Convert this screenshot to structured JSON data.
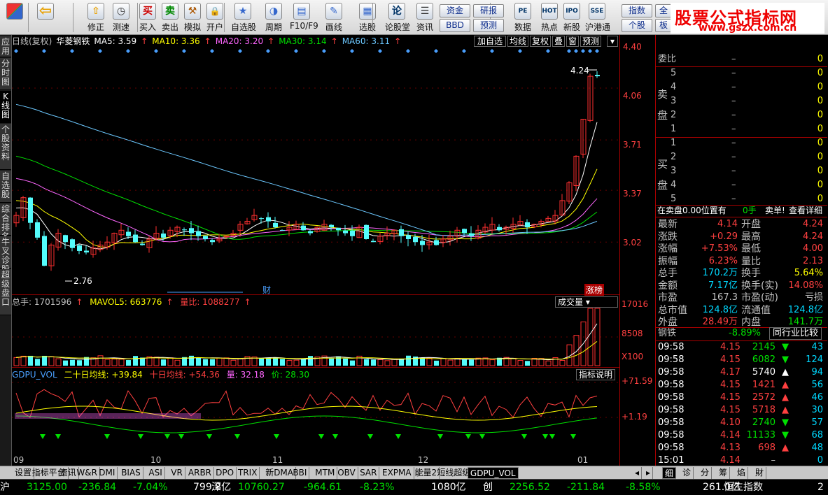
{
  "toolbar": {
    "buttons": [
      {
        "label": "",
        "icon": "app-grid-icon"
      },
      {
        "label": "",
        "icon": "back-arrow-icon"
      },
      {
        "label": "修正",
        "icon": "fix-icon"
      },
      {
        "label": "测速",
        "icon": "clock-icon"
      },
      {
        "label": "买入",
        "icon": "buy-icon",
        "glyph": "买"
      },
      {
        "label": "卖出",
        "icon": "sell-icon",
        "glyph": "卖"
      },
      {
        "label": "模拟",
        "icon": "hammer-icon"
      },
      {
        "label": "开户",
        "icon": "lock-icon"
      },
      {
        "label": "自选股",
        "icon": "star-icon"
      },
      {
        "label": "周期",
        "icon": "period-icon"
      },
      {
        "label": "F10/F9",
        "icon": "f10-icon"
      },
      {
        "label": "画线",
        "icon": "pen-icon"
      },
      {
        "label": "选股",
        "icon": "select-icon"
      },
      {
        "label": "论股堂",
        "icon": "discuss-icon",
        "glyph": "论"
      },
      {
        "label": "资讯",
        "icon": "news-icon"
      },
      {
        "label": "数据",
        "icon": "pe-icon",
        "glyph": "PE"
      },
      {
        "label": "热点",
        "icon": "hot-icon",
        "glyph": "HOT"
      },
      {
        "label": "新股",
        "icon": "ipo-icon",
        "glyph": "IPO"
      },
      {
        "label": "沪港通",
        "icon": "sse-hkex-icon",
        "glyph": "SSE"
      }
    ],
    "small": [
      {
        "label": "资金"
      },
      {
        "label": "BBD"
      },
      {
        "label": "研报"
      },
      {
        "label": "预测"
      },
      {
        "label": "指数"
      },
      {
        "label": "个股"
      },
      {
        "label": "全"
      },
      {
        "label": "板"
      }
    ]
  },
  "logo": {
    "title": "股票公式指标网",
    "url": "www.gszx.com.cn"
  },
  "left_tabs": [
    "应用",
    "分时图",
    "K线图",
    "个股资料",
    "自选股",
    "综合排名",
    "牛叉诊股",
    "超级盘口"
  ],
  "main": {
    "period": "日线(复权)",
    "stock_name": "华菱钢铁",
    "ma": [
      {
        "label": "MA5: 3.59",
        "color": "#ffffff"
      },
      {
        "label": "MA10: 3.36",
        "color": "#ffff00"
      },
      {
        "label": "MA20: 3.20",
        "color": "#ff66ff"
      },
      {
        "label": "MA30: 3.14",
        "color": "#00e000"
      },
      {
        "label": "MA60: 3.11",
        "color": "#6cc8ff"
      }
    ],
    "buttons": [
      "加自选",
      "均线",
      "复权",
      "叠",
      "窗",
      "预测"
    ],
    "high_label": "4.24",
    "low_label": "2.76",
    "cai_label": "财",
    "zhang_label": "涨榜",
    "watermark": "华菱钢铁 000932"
  },
  "volume": {
    "label_total": "总手: 1701596",
    "label_mavol": "MAVOL5: 663776",
    "label_ratio": "量比: 1088277",
    "menu": "成交量"
  },
  "indicator": {
    "name": "GDPU_VOL",
    "ma20": "二十日均线: +39.84",
    "ma10": "十日均线: +54.36",
    "vol": "量: 32.18",
    "price": "价: 28.30",
    "help": "指标说明"
  },
  "y_axis": {
    "price": [
      "4.40",
      "4.06",
      "3.71",
      "3.37",
      "3.02"
    ],
    "volume": [
      "17016",
      "8508",
      "X100"
    ],
    "indicator": [
      "+71.59",
      "+1.19"
    ]
  },
  "x_axis": [
    "09",
    "10",
    "11",
    "12",
    "01"
  ],
  "chart_data": {
    "type": "candlestick",
    "title": "华菱钢铁 日线(复权)",
    "ylim": [
      2.7,
      4.4
    ],
    "x_ticks": [
      "09",
      "10",
      "11",
      "12",
      "01"
    ],
    "last_close": 4.14,
    "period_high": 4.24,
    "period_low": 2.76,
    "ma_latest": {
      "MA5": 3.59,
      "MA10": 3.36,
      "MA20": 3.2,
      "MA30": 3.14,
      "MA60": 3.11
    },
    "volume_ylim": [
      0,
      17016
    ],
    "volume_ticks": [
      17016,
      8508
    ]
  },
  "right": {
    "order_ratio": "委比",
    "order_ratio_val": "–",
    "order_ratio_num": "0",
    "sell_label": "卖盘",
    "buy_label": "买盘",
    "sell": [
      {
        "lvl": "5",
        "p": "–",
        "v": "0"
      },
      {
        "lvl": "4",
        "p": "–",
        "v": "0"
      },
      {
        "lvl": "3",
        "p": "–",
        "v": "0"
      },
      {
        "lvl": "2",
        "p": "–",
        "v": "0"
      },
      {
        "lvl": "1",
        "p": "–",
        "v": "0"
      }
    ],
    "buy": [
      {
        "lvl": "1",
        "p": "–",
        "v": "0"
      },
      {
        "lvl": "2",
        "p": "–",
        "v": "0"
      },
      {
        "lvl": "3",
        "p": "–",
        "v": "0"
      },
      {
        "lvl": "4",
        "p": "–",
        "v": "0"
      },
      {
        "lvl": "5",
        "p": "–",
        "v": "0"
      }
    ],
    "notice": "在卖盘0.00位置有",
    "notice_val": "0手",
    "notice_btn1": "卖单!",
    "notice_btn2": "查看详细",
    "stats": [
      [
        "最新",
        "4.14",
        "开盘",
        "4.24"
      ],
      [
        "涨跌",
        "+0.29",
        "最高",
        "4.24"
      ],
      [
        "涨幅",
        "+7.53%",
        "最低",
        "4.00"
      ],
      [
        "振幅",
        "6.23%",
        "量比",
        "2.13"
      ],
      [
        "总手",
        "170.2万",
        "换手",
        "5.64%"
      ],
      [
        "金额",
        "7.17亿",
        "换手(实)",
        "14.08%"
      ],
      [
        "市盈",
        "167.3",
        "市盈(动)",
        "亏损"
      ],
      [
        "总市值",
        "124.8亿",
        "流通值",
        "124.8亿"
      ],
      [
        "外盘",
        "28.49万",
        "内盘",
        "141.7万"
      ]
    ],
    "sector": "钢铁",
    "sector_pct": "-8.89%",
    "sector_btn": "同行业比较",
    "ticks": [
      {
        "t": "09:58",
        "p": "4.15",
        "v": "2145",
        "d": "down",
        "n": "43"
      },
      {
        "t": "09:58",
        "p": "4.15",
        "v": "6082",
        "d": "down",
        "n": "124"
      },
      {
        "t": "09:58",
        "p": "4.17",
        "v": "5740",
        "d": "up",
        "n": "94"
      },
      {
        "t": "09:58",
        "p": "4.15",
        "v": "1421",
        "d": "up",
        "n": "56"
      },
      {
        "t": "09:58",
        "p": "4.15",
        "v": "2572",
        "d": "up",
        "n": "46"
      },
      {
        "t": "09:58",
        "p": "4.15",
        "v": "5718",
        "d": "up",
        "n": "30"
      },
      {
        "t": "09:58",
        "p": "4.10",
        "v": "2740",
        "d": "down",
        "n": "57"
      },
      {
        "t": "09:58",
        "p": "4.14",
        "v": "11133",
        "d": "down",
        "n": "68"
      },
      {
        "t": "09:58",
        "p": "4.13",
        "v": "698",
        "d": "up",
        "n": "48"
      },
      {
        "t": "15:01",
        "p": "4.14",
        "v": "–",
        "d": "",
        "n": "0"
      }
    ],
    "bottom_tabs": [
      "细",
      "诊",
      "分",
      "筹",
      "焰",
      "財"
    ]
  },
  "bottom_tabs": [
    "设置",
    "指标平台",
    "资讯",
    "W&R",
    "DMI",
    "BIAS",
    "ASI",
    "VR",
    "ARBR",
    "DPO",
    "TRIX",
    "新DMA",
    "BBI",
    "MTM",
    "OBV",
    "SAR",
    "EXPMA",
    "能量2",
    "短线超级1",
    "GDPU_VOL"
  ],
  "status": [
    {
      "k": "沪",
      "v": "3125.00",
      "c": "-236.84",
      "p": "-7.04%",
      "amt": "799.8亿"
    },
    {
      "k": "深",
      "v": "10760.27",
      "c": "-964.61",
      "p": "-8.23%",
      "amt": "1080亿"
    },
    {
      "k": "创",
      "v": "2256.52",
      "c": "-211.84",
      "p": "-8.58%",
      "amt": "261.0亿"
    }
  ],
  "status_extra": "恒生指数",
  "status_tail": "2"
}
